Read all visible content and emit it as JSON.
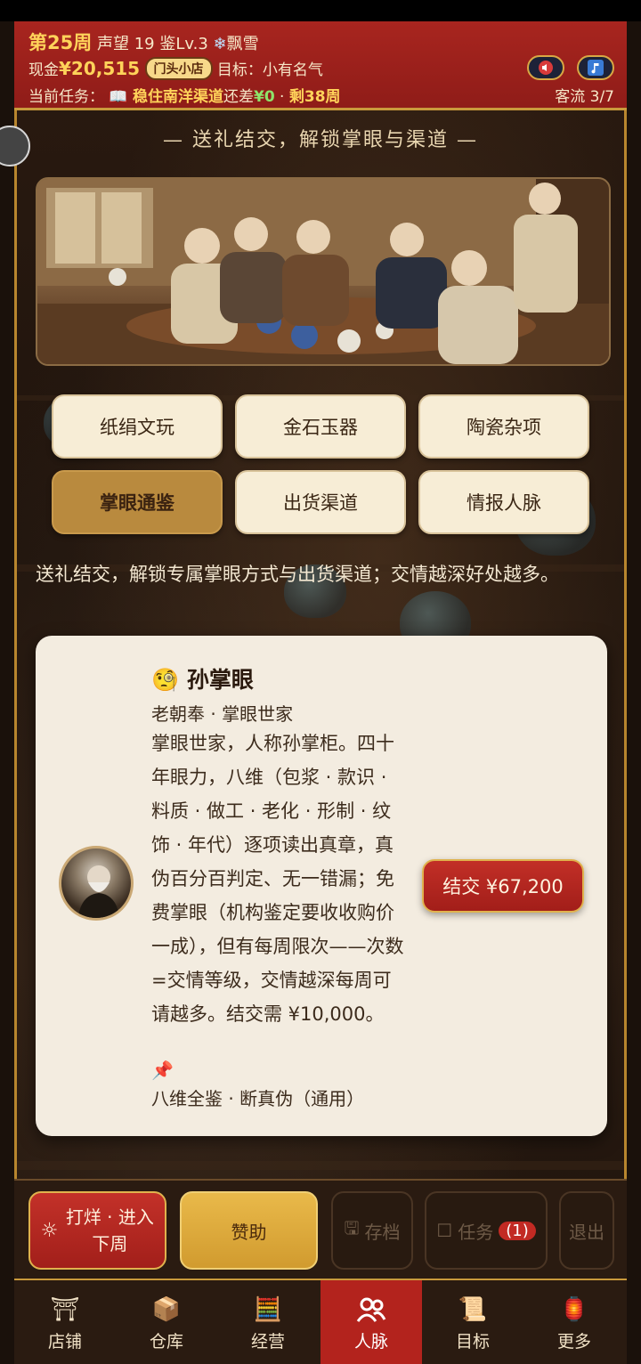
{
  "header": {
    "week": "第25周",
    "reputation": "声望 19",
    "appraisal_level": "鉴Lv.3",
    "weather": "飘雪",
    "cash_label": "现金",
    "cash_value": "¥20,515",
    "shop_level": "门头小店",
    "goal": "目标：小有名气",
    "task_label": "当前任务：",
    "task_name": "稳住南洋渠道",
    "task_gap_label": "还差",
    "task_gap_value": "¥0",
    "task_sep": " · ",
    "task_remaining": "剩38周",
    "traffic": "客流 3/7"
  },
  "subtitle": "— 送礼结交，解锁掌眼与渠道 —",
  "categories": [
    {
      "label": "纸绢文玩"
    },
    {
      "label": "金石玉器"
    },
    {
      "label": "陶瓷杂项"
    },
    {
      "label": "掌眼通鉴",
      "active": true
    },
    {
      "label": "出货渠道"
    },
    {
      "label": "情报人脉"
    }
  ],
  "intro": "送礼结交，解锁专属掌眼方式与出货渠道；交情越深好处越多。",
  "card": {
    "emoji": "🧐",
    "name": "孙掌眼",
    "subtitle": "老朝奉 · 掌眼世家",
    "description": "掌眼世家，人称孙掌柜。四十年眼力，八维（包浆 · 款识 · 料质 · 做工 · 老化 · 形制 · 纹饰 · 年代）逐项读出真章，真伪百分百判定、无一错漏；免费掌眼（机构鉴定要收收购价一成），但有每周限次——次数=交情等级，交情越深每周可请越多。结交需 ¥10,000。",
    "tag": "八维全鉴 · 断真伪（通用）",
    "befriend_button": "结交 ¥67,200"
  },
  "actions": {
    "next_week": "打烊 · 进入下周",
    "sponsor": "赞助",
    "save": "存档",
    "tasks": "任务",
    "tasks_badge": "(1)",
    "exit": "退出"
  },
  "tabs": [
    {
      "label": "店铺",
      "icon": "shop-icon"
    },
    {
      "label": "仓库",
      "icon": "warehouse-icon"
    },
    {
      "label": "经营",
      "icon": "abacus-icon"
    },
    {
      "label": "人脉",
      "icon": "people-icon",
      "active": true
    },
    {
      "label": "目标",
      "icon": "scroll-icon"
    },
    {
      "label": "更多",
      "icon": "more-icon"
    }
  ],
  "colors": {
    "header_red": "#a8251f",
    "gold": "#ffd35a",
    "active_category": "#b98a3e",
    "tab_active": "#b3231d"
  }
}
